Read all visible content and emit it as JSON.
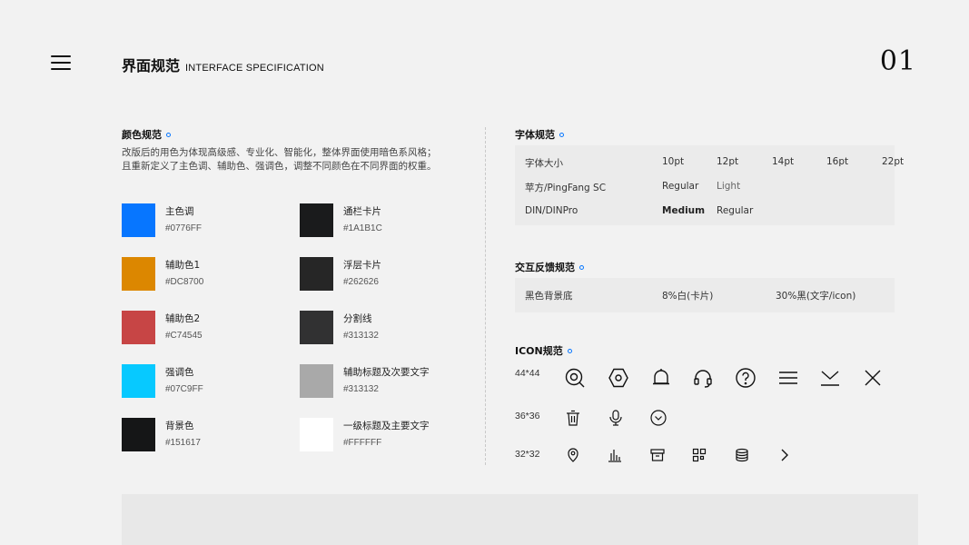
{
  "header": {
    "title_cn": "界面规范",
    "title_en": "INTERFACE SPECIFICATION",
    "page_number": "01"
  },
  "color_section": {
    "title": "颜色规范",
    "description": [
      "改版后的用色为体现高级感、专业化、智能化，整体界面使用暗色系风格；",
      "且重新定义了主色调、辅助色、强调色，调整不同颜色在不同界面的权重。"
    ],
    "swatches": [
      {
        "name": "主色调",
        "hex": "#0776FF",
        "color": "#0776FF"
      },
      {
        "name": "通栏卡片",
        "hex": "#1A1B1C",
        "color": "#1A1B1C"
      },
      {
        "name": "辅助色1",
        "hex": "#DC8700",
        "color": "#DC8700"
      },
      {
        "name": "浮层卡片",
        "hex": "#262626",
        "color": "#262626"
      },
      {
        "name": "辅助色2",
        "hex": "#C74545",
        "color": "#C74545"
      },
      {
        "name": "分割线",
        "hex": "#313132",
        "color": "#313132"
      },
      {
        "name": "强调色",
        "hex": "#07C9FF",
        "color": "#07C9FF"
      },
      {
        "name": "辅助标题及次要文字",
        "hex": "#313132",
        "color": "#A9A9A9"
      },
      {
        "name": "背景色",
        "hex": "#151617",
        "color": "#151617"
      },
      {
        "name": "一级标题及主要文字",
        "hex": "#FFFFFF",
        "color": "#FFFFFF"
      }
    ]
  },
  "font_section": {
    "title": "字体规范",
    "rows": [
      {
        "label": "字体大小",
        "values": [
          "10pt",
          "12pt",
          "14pt",
          "16pt",
          "22pt"
        ]
      },
      {
        "label": "苹方/PingFang SC",
        "values": [
          "Regular",
          "Light"
        ]
      },
      {
        "label": "DIN/DINPro",
        "values": [
          "Medium",
          "Regular"
        ]
      }
    ]
  },
  "feedback_section": {
    "title": "交互反馈规范",
    "values": [
      "黑色背景底",
      "8%白(卡片)",
      "30%黑(文字/icon)"
    ]
  },
  "icon_section": {
    "title": "ICON规范",
    "sizes": [
      "44*44",
      "36*36",
      "32*32"
    ],
    "row_44": [
      "search-icon",
      "hexagon-icon",
      "bell-icon",
      "headset-icon",
      "help-icon",
      "menu-icon",
      "inbox-down-icon",
      "close-icon"
    ],
    "row_36": [
      "trash-icon",
      "microphone-icon",
      "chevron-down-circle-icon"
    ],
    "row_32": [
      "location-pin-icon",
      "bar-chart-icon",
      "archive-icon",
      "grid-icon",
      "database-icon",
      "chevron-right-icon"
    ]
  }
}
